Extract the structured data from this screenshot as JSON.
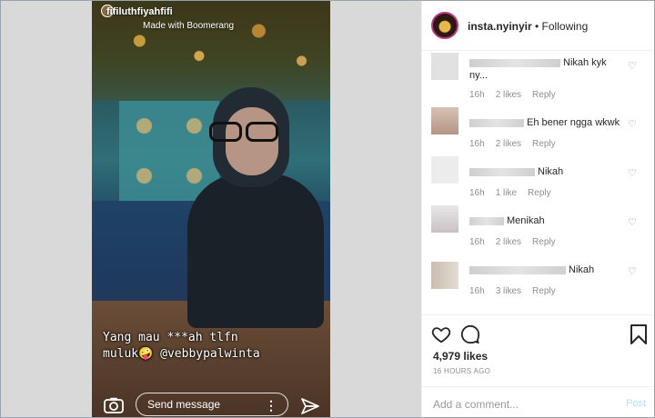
{
  "story": {
    "username": "fifiluthfiyahfifi",
    "subtitle": "Made with Boomerang",
    "caption_line1": "Yang mau ***ah tlfn",
    "caption_line2": "muluk🤪 @vebbypalwinta",
    "send_placeholder": "Send message",
    "more_label": "⋮"
  },
  "header": {
    "username": "insta.nyinyir",
    "follow_status": " • Following"
  },
  "comments": [
    {
      "text": "Nikah kyk",
      "text2": "ny...",
      "age": "16h",
      "likes": "2 likes",
      "reply": "Reply"
    },
    {
      "text": "Eh bener ngga wkwk",
      "age": "16h",
      "likes": "2 likes",
      "reply": "Reply"
    },
    {
      "text": "Nikah",
      "age": "16h",
      "likes": "1 like",
      "reply": "Reply"
    },
    {
      "text": "Menikah",
      "age": "16h",
      "likes": "2 likes",
      "reply": "Reply"
    },
    {
      "text": "Nikah",
      "age": "16h",
      "likes": "3 likes",
      "reply": "Reply"
    }
  ],
  "footer": {
    "likes": "4,979 likes",
    "time": "16 HOURS AGO",
    "add_comment_placeholder": "Add a comment...",
    "post_label": "Post"
  },
  "icons": {
    "heart": "heart-icon",
    "comment": "comment-bubble-icon",
    "bookmark": "bookmark-icon",
    "camera": "camera-icon",
    "send": "send-icon"
  },
  "colors": {
    "text": "#262626",
    "muted": "#8e8e8e",
    "post_disabled": "#b2dffc",
    "story_ring": "#c13584"
  }
}
